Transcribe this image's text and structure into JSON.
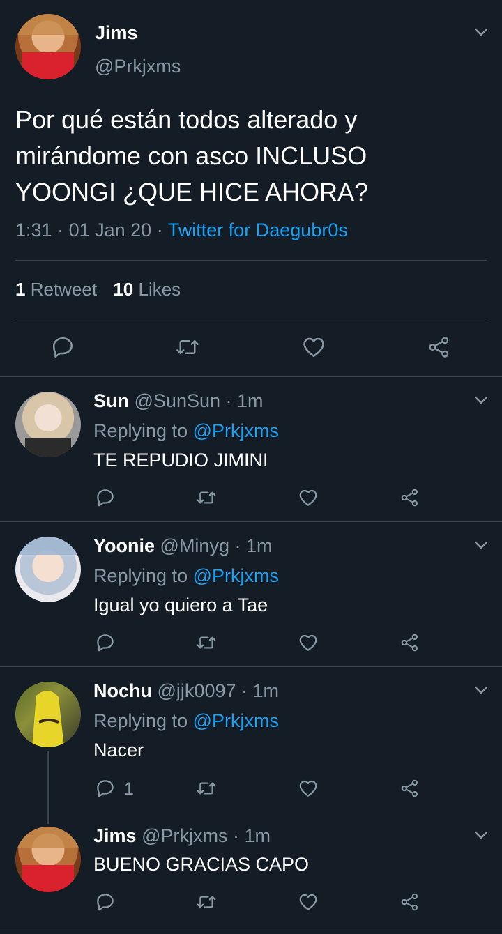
{
  "main_tweet": {
    "display_name": "Jims",
    "handle": "@Prkjxms",
    "text_lines": [
      "Por qué están todos alterado y",
      "mirándome con asco INCLUSO",
      "YOONGI ¿QUE HICE AHORA?"
    ],
    "time": "1:31",
    "sep1": "·",
    "date": "01 Jan 20",
    "sep2": "·",
    "source": "Twitter for Daegubr0s",
    "retweet_count": "1",
    "retweet_label": "Retweet",
    "like_count": "10",
    "like_label": "Likes"
  },
  "replies": [
    {
      "name": "Sun",
      "handle": "@SunSun",
      "time": "· 1m",
      "replying_prefix": "Replying to",
      "replying_to": "@Prkjxms",
      "text": "TE REPUDIO JIMINI",
      "reply_count": ""
    },
    {
      "name": "Yoonie",
      "handle": "@Minyg",
      "time": "· 1m",
      "replying_prefix": "Replying to",
      "replying_to": "@Prkjxms",
      "text": "Igual yo quiero a Tae",
      "reply_count": ""
    },
    {
      "name": "Nochu",
      "handle": "@jjk0097",
      "time": "· 1m",
      "replying_prefix": "Replying to",
      "replying_to": "@Prkjxms",
      "text": "Nacer",
      "reply_count": "1"
    },
    {
      "name": "Jims",
      "handle": "@Prkjxms",
      "time": "· 1m",
      "text": "BUENO GRACIAS CAPO",
      "reply_count": ""
    }
  ],
  "colors": {
    "background": "#141d26",
    "accent": "#1da1f2",
    "secondary_text": "#8899a6",
    "divider": "#38444d"
  }
}
